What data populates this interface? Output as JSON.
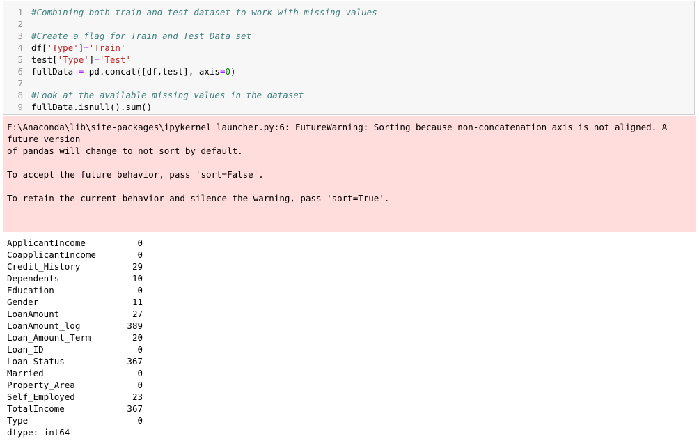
{
  "code_cell": {
    "lines": [
      {
        "num": "1",
        "tokens": [
          {
            "t": "comment",
            "v": "#Combining both train and test dataset to work with missing values"
          }
        ]
      },
      {
        "num": "2",
        "tokens": []
      },
      {
        "num": "3",
        "tokens": [
          {
            "t": "comment",
            "v": "#Create a flag for Train and Test Data set"
          }
        ]
      },
      {
        "num": "4",
        "tokens": [
          {
            "t": "plain",
            "v": "df["
          },
          {
            "t": "string",
            "v": "'Type'"
          },
          {
            "t": "plain",
            "v": "]"
          },
          {
            "t": "op",
            "v": "="
          },
          {
            "t": "string",
            "v": "'Train'"
          }
        ]
      },
      {
        "num": "5",
        "tokens": [
          {
            "t": "plain",
            "v": "test["
          },
          {
            "t": "string",
            "v": "'Type'"
          },
          {
            "t": "plain",
            "v": "]"
          },
          {
            "t": "op",
            "v": "="
          },
          {
            "t": "string",
            "v": "'Test'"
          }
        ]
      },
      {
        "num": "6",
        "tokens": [
          {
            "t": "plain",
            "v": "fullData "
          },
          {
            "t": "op",
            "v": "="
          },
          {
            "t": "plain",
            "v": " pd.concat([df,test], axis"
          },
          {
            "t": "op",
            "v": "="
          },
          {
            "t": "number",
            "v": "0"
          },
          {
            "t": "plain",
            "v": ")"
          }
        ]
      },
      {
        "num": "7",
        "tokens": []
      },
      {
        "num": "8",
        "tokens": [
          {
            "t": "comment",
            "v": "#Look at the available missing values in the dataset"
          }
        ]
      },
      {
        "num": "9",
        "tokens": [
          {
            "t": "plain",
            "v": "fullData.isnull().sum()"
          }
        ]
      }
    ]
  },
  "stderr": {
    "lines": [
      "F:\\Anaconda\\lib\\site-packages\\ipykernel_launcher.py:6: FutureWarning: Sorting because non-concatenation axis is not aligned. A",
      "future version",
      "of pandas will change to not sort by default.",
      "",
      "To accept the future behavior, pass 'sort=False'.",
      "",
      "To retain the current behavior and silence the warning, pass 'sort=True'."
    ]
  },
  "stdout": {
    "rows": [
      {
        "name": "ApplicantIncome",
        "value": "0"
      },
      {
        "name": "CoapplicantIncome",
        "value": "0"
      },
      {
        "name": "Credit_History",
        "value": "29"
      },
      {
        "name": "Dependents",
        "value": "10"
      },
      {
        "name": "Education",
        "value": "0"
      },
      {
        "name": "Gender",
        "value": "11"
      },
      {
        "name": "LoanAmount",
        "value": "27"
      },
      {
        "name": "LoanAmount_log",
        "value": "389"
      },
      {
        "name": "Loan_Amount_Term",
        "value": "20"
      },
      {
        "name": "Loan_ID",
        "value": "0"
      },
      {
        "name": "Loan_Status",
        "value": "367"
      },
      {
        "name": "Married",
        "value": "0"
      },
      {
        "name": "Property_Area",
        "value": "0"
      },
      {
        "name": "Self_Employed",
        "value": "23"
      },
      {
        "name": "TotalIncome",
        "value": "367"
      },
      {
        "name": "Type",
        "value": "0"
      }
    ],
    "dtype": "dtype: int64"
  },
  "colors": {
    "code_background": "#f7f7f7",
    "stderr_background": "#ffdddd",
    "comment": "#408080",
    "string": "#ba2121",
    "number": "#008000",
    "operator": "#aa22ff"
  }
}
